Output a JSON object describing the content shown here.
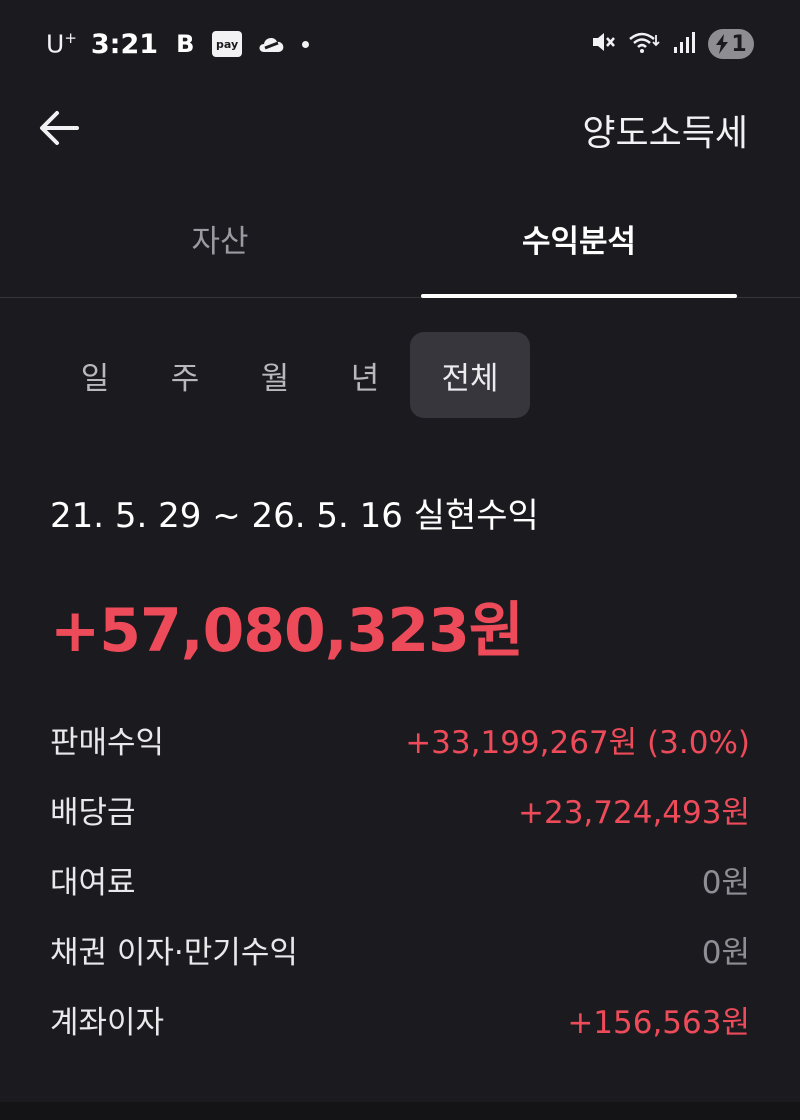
{
  "status_bar": {
    "carrier": "U",
    "carrier_sup": "+",
    "time": "3:21",
    "app_b": "B",
    "app_pay": "pay",
    "icons": [
      "b-app-icon",
      "pay-app-icon",
      "cloud-app-icon",
      "notification-dot",
      "mute-icon",
      "wifi-icon",
      "signal-icon",
      "battery-icon"
    ],
    "battery_text": "1"
  },
  "header": {
    "back_icon": "arrow-left-icon",
    "title": "양도소득세"
  },
  "tabs": [
    {
      "label": "자산",
      "active": false
    },
    {
      "label": "수익분석",
      "active": true
    }
  ],
  "periods": [
    {
      "label": "일",
      "selected": false
    },
    {
      "label": "주",
      "selected": false
    },
    {
      "label": "월",
      "selected": false
    },
    {
      "label": "년",
      "selected": false
    },
    {
      "label": "전체",
      "selected": true
    }
  ],
  "summary": {
    "range_label": "21. 5. 29 ~ 26. 5. 16 실현수익",
    "total": "+57,080,323원"
  },
  "breakdown": [
    {
      "label": "판매수익",
      "value": "+33,199,267원 (3.0%)"
    },
    {
      "label": "배당금",
      "value": "+23,724,493원"
    },
    {
      "label": "대여료",
      "value": "0원"
    },
    {
      "label": "채권 이자·만기수익",
      "value": "0원"
    },
    {
      "label": "계좌이자",
      "value": "+156,563원"
    }
  ],
  "colors": {
    "background": "#1b1b1f",
    "positive": "#ee4b5a",
    "neutral": "#8e8e94",
    "selected_chip": "#36363c"
  }
}
